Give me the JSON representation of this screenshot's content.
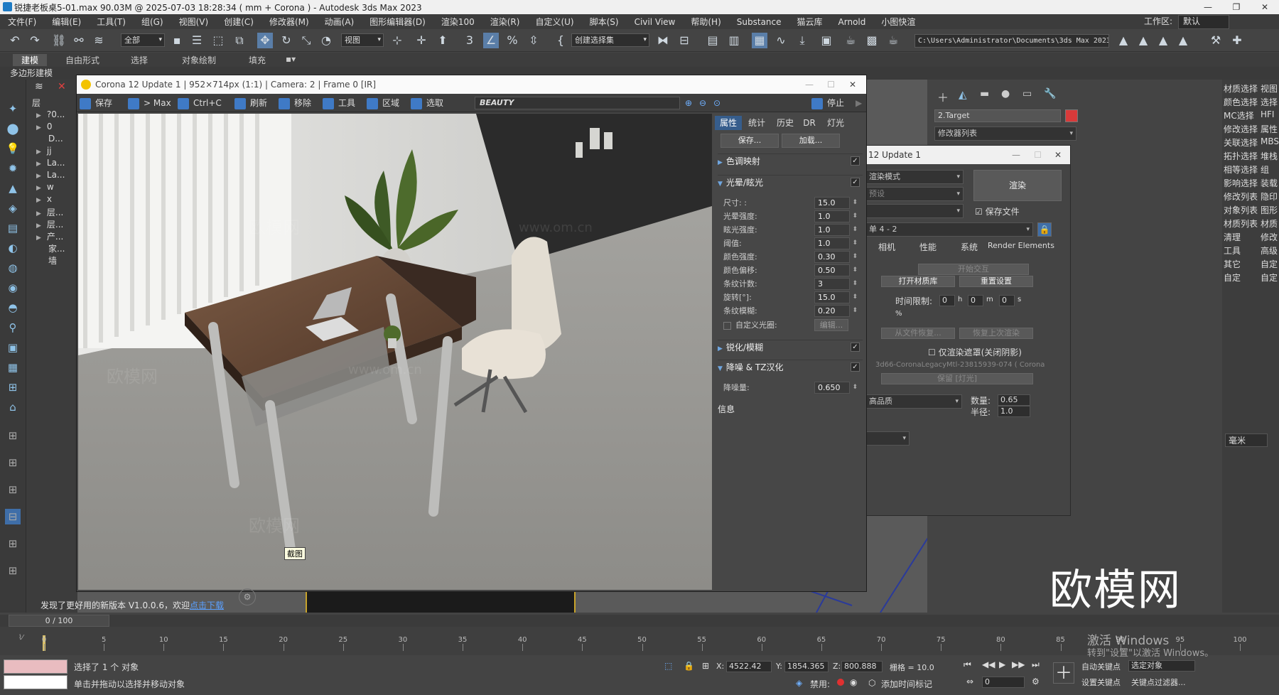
{
  "titlebar": {
    "title": "锐捷老板桌5-01.max  90.03M @ 2025-07-03 18:28:34  ( mm + Corona ) - Autodesk 3ds Max 2023",
    "minimize": "—",
    "restore": "❐",
    "close": "✕"
  },
  "menu": {
    "items": [
      "文件(F)",
      "编辑(E)",
      "工具(T)",
      "组(G)",
      "视图(V)",
      "创建(C)",
      "修改器(M)",
      "动画(A)",
      "图形编辑器(D)",
      "渲染100",
      "渲染(R)",
      "自定义(U)",
      "脚本(S)",
      "Civil View",
      "帮助(H)",
      "Substance",
      "猫云库",
      "Arnold",
      "小图快渲"
    ],
    "workspace_label": "工作区:",
    "workspace_value": "默认"
  },
  "toolbar": {
    "filter": "全部",
    "view": "视图",
    "selection_set": "创建选择集",
    "project_path": "C:\\Users\\Administrator\\Documents\\3ds Max 2023"
  },
  "ribbon": {
    "tabs": [
      "建模",
      "自由形式",
      "选择",
      "对象绘制",
      "填充"
    ],
    "sub_label": "多边形建模"
  },
  "scene_explorer": {
    "header": "层",
    "rows": [
      "?0...",
      "0",
      "D...",
      "jj",
      "La...",
      "La...",
      "w",
      "x",
      "层...",
      "层...",
      "产...",
      "家...",
      "墙"
    ]
  },
  "vfb": {
    "title": "Corona 12 Update 1 | 952×714px (1:1) | Camera: 2 | Frame 0 [IR]",
    "toolbar": [
      "保存",
      "> Max",
      "Ctrl+C",
      "刷新",
      "移除",
      "工具",
      "区域",
      "选取"
    ],
    "pass": "BEAUTY",
    "stop": "停止",
    "render": "渲染",
    "tabs": [
      "属性",
      "统计",
      "历史",
      "DR",
      "灯光"
    ],
    "save_btn": "保存...",
    "load_btn": "加载...",
    "sections": {
      "tone": "色调映射",
      "bloom": "光晕/眩光",
      "sharpen": "锐化/模糊",
      "denoise": "降噪 & TZ汉化",
      "info": "信息"
    },
    "bloom_params": [
      {
        "label": "尺寸: :",
        "value": "15.0"
      },
      {
        "label": "光晕强度:",
        "value": "1.0"
      },
      {
        "label": "眩光强度:",
        "value": "1.0"
      },
      {
        "label": "阈值:",
        "value": "1.0"
      },
      {
        "label": "颜色强度:",
        "value": "0.30"
      },
      {
        "label": "颜色偏移:",
        "value": "0.50"
      },
      {
        "label": "条纹计数:",
        "value": "3"
      },
      {
        "label": "旋转[°]:",
        "value": "15.0"
      },
      {
        "label": "条纹模糊:",
        "value": "0.20"
      }
    ],
    "custom_aperture": "自定义光圈:",
    "edit_btn": "编辑...",
    "denoise_label": "降噪量:",
    "denoise_value": "0.650",
    "screenshot_tooltip": "截图"
  },
  "render_setup": {
    "title": "12 Update 1",
    "render_mode": "渲染模式",
    "preset": "预设",
    "render_btn": "渲染",
    "save_file": "保存文件",
    "view": "单 4 - 2",
    "tabs": [
      "相机",
      "性能",
      "系统",
      "Render Elements"
    ],
    "start_interactive": "开始交互",
    "open_material": "打开材质库",
    "reset": "重置设置",
    "time_limit": "时间限制:",
    "time_h": "0",
    "time_m": "0",
    "time_s": "0",
    "h": "h",
    "m": "m",
    "s": "s",
    "percent": "%",
    "resume_file": "从文件恢复...",
    "resume_last": "恢复上次渲染",
    "mask_only": "仅渲染遮罩(关闭阴影)",
    "material_name": "3d66-CoronaLegacyMtl-23815939-074  ( Corona",
    "keep_light": "保留 [灯光]",
    "quality": "高品质",
    "count_label": "数量:",
    "count_value": "0.65",
    "radius_label": "半径:",
    "radius_value": "1.0"
  },
  "command_panel": {
    "object_name": "2.Target",
    "modifier_list": "修改器列表",
    "object_color": "#d83a3a"
  },
  "right_column": {
    "items": [
      "材质选择",
      "视图",
      "颜色选择",
      "选择",
      "MC选择",
      "HFI",
      "修改选择",
      "属性",
      "关联选择",
      "MBS",
      "拓扑选择",
      "堆栈",
      "相等选择",
      "组",
      "影响选择",
      "装载",
      "修改列表",
      "隐印",
      "对象列表",
      "图形",
      "材质列表",
      "材质",
      "清理",
      "修改",
      "工具",
      "高级",
      "其它",
      "自定",
      "自定",
      "自定"
    ],
    "unit": "毫米"
  },
  "notice": {
    "text": "发现了更好用的新版本 V1.0.0.6，欢迎",
    "link": "点击下载"
  },
  "timeline": {
    "slider": "0 / 100",
    "ticks": [
      0,
      5,
      10,
      15,
      20,
      25,
      30,
      35,
      40,
      45,
      50,
      55,
      60,
      65,
      70,
      75,
      80,
      85,
      90,
      95,
      100
    ]
  },
  "status": {
    "selected": "选择了 1 个 对象",
    "hint": "单击并拖动以选择并移动对象",
    "x_label": "X:",
    "x": "4522.42",
    "y_label": "Y:",
    "y": "1854.365",
    "z_label": "Z:",
    "z": "800.888",
    "grid": "栅格 = 10.0",
    "disable": "禁用:",
    "add_time_tag": "添加时间标记",
    "auto_key": "自动关键点",
    "set_key": "设置关键点",
    "selected_object": "选定对象",
    "key_filter": "关键点过滤器...",
    "frame": "0"
  },
  "watermark": {
    "brand": "欧模网",
    "url": "www.om.cn"
  },
  "windows": {
    "activate": "激活 Windows",
    "activate_hint": "转到\"设置\"以激活 Windows。"
  }
}
